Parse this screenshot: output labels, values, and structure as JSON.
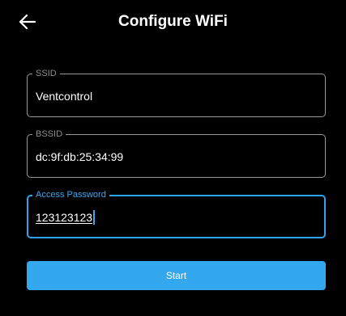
{
  "header": {
    "title": "Configure WiFi",
    "back_icon": "arrow-left-icon"
  },
  "form": {
    "ssid": {
      "label": "SSID",
      "value": "Ventcontrol"
    },
    "bssid": {
      "label": "BSSID",
      "value": "dc:9f:db:25:34:99"
    },
    "password": {
      "label": "Access Password",
      "value": "123123123",
      "focused": true
    }
  },
  "actions": {
    "start_label": "Start"
  },
  "colors": {
    "background": "#000000",
    "accent": "#33a8ef",
    "border": "#9a9a9a",
    "text": "#ffffff"
  }
}
